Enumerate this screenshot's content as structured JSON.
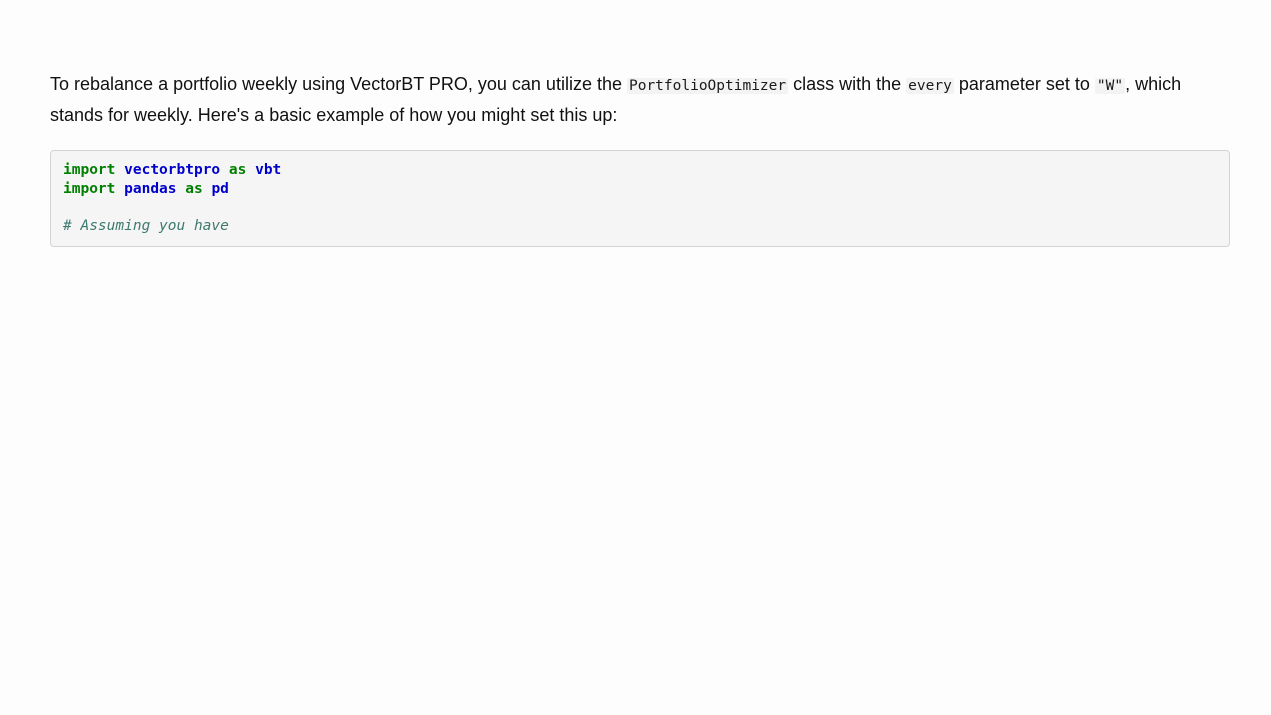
{
  "paragraph": {
    "t1": "To rebalance a portfolio weekly using VectorBT PRO, you can utilize the ",
    "code1": "PortfolioOptimizer",
    "t2": " class with the ",
    "code2": "every",
    "t3": " parameter set to ",
    "code3": "\"W\"",
    "t4": ", which stands for weekly. Here's a basic example of how you might set this up:"
  },
  "code": {
    "line1": {
      "kw1": "import",
      "mod": "vectorbtpro",
      "kw2": "as",
      "alias": "vbt"
    },
    "line2": {
      "kw1": "import",
      "mod": "pandas",
      "kw2": "as",
      "alias": "pd"
    },
    "comment": "# Assuming you have"
  },
  "colors": {
    "keyword": "#008000",
    "name": "#0000cc",
    "comment": "#3d7a6e",
    "code_bg": "#f5f5f5"
  }
}
